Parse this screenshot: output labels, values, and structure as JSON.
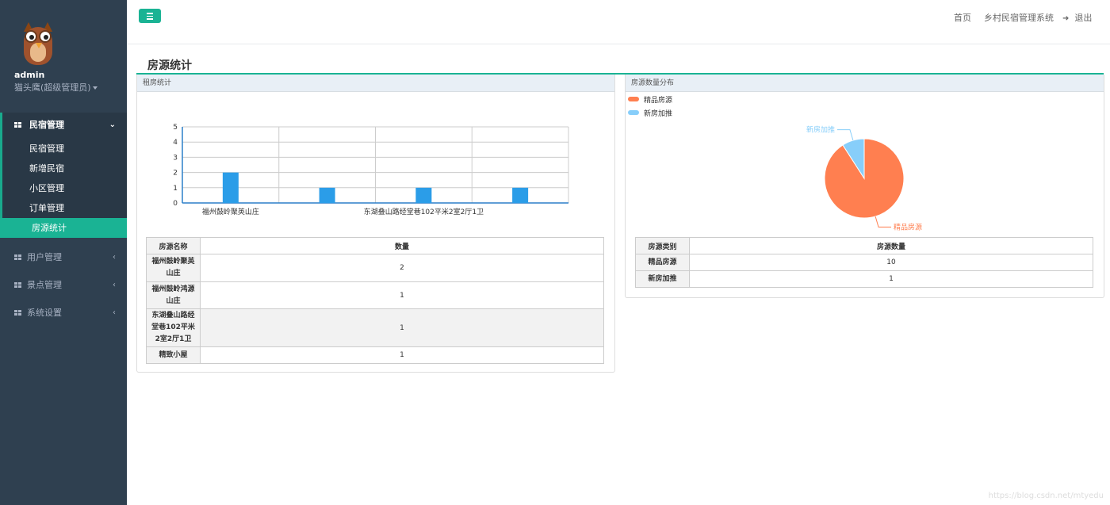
{
  "user": {
    "name": "admin",
    "role": "猫头鹰(超级管理员)"
  },
  "sidebar": {
    "groups": [
      {
        "label": "民宿管理",
        "items": [
          "民宿管理",
          "新增民宿",
          "小区管理",
          "订单管理",
          "房源统计"
        ],
        "active_item": "房源统计"
      },
      {
        "label": "用户管理"
      },
      {
        "label": "景点管理"
      },
      {
        "label": "系统设置"
      }
    ]
  },
  "topbar": {
    "home": "首页",
    "system": "乡村民宿管理系统",
    "logout": "退出"
  },
  "page": {
    "title": "房源统计"
  },
  "left_panel": {
    "title": "租房统计",
    "table": {
      "headers": [
        "房源名称",
        "数量"
      ],
      "rows": [
        {
          "name": "福州鼓岭聚英山庄",
          "count": "2"
        },
        {
          "name": "福州鼓岭鸿源山庄",
          "count": "1"
        },
        {
          "name": "东湖叠山路经堂巷102平米2室2厅1卫",
          "count": "1"
        },
        {
          "name": "精致小屋",
          "count": "1"
        }
      ]
    }
  },
  "right_panel": {
    "title": "房源数量分布",
    "legend": [
      {
        "label": "精品房源",
        "color": "#ff7f50"
      },
      {
        "label": "新房加推",
        "color": "#87cefa"
      }
    ],
    "table": {
      "headers": [
        "房源类别",
        "房源数量"
      ],
      "rows": [
        {
          "name": "精品房源",
          "count": "10"
        },
        {
          "name": "新房加推",
          "count": "1"
        }
      ]
    }
  },
  "chart_data": [
    {
      "type": "bar",
      "categories": [
        "福州鼓岭聚英山庄",
        "福州鼓岭鸿源山庄",
        "东湖叠山路经堂巷102平米2室2厅1卫",
        "精致小屋"
      ],
      "visible_category_labels": [
        "福州鼓岭聚英山庄",
        "",
        "东湖叠山路经堂巷102平米2室2厅1卫",
        ""
      ],
      "values": [
        2,
        1,
        1,
        1
      ],
      "ylim": [
        0,
        5
      ],
      "yticks": [
        "0",
        "1",
        "2",
        "3",
        "4",
        "5"
      ],
      "color": "#2b9de8",
      "grid": true
    },
    {
      "type": "pie",
      "labels": [
        "精品房源",
        "新房加推"
      ],
      "values": [
        10,
        1
      ],
      "colors": [
        "#ff7f50",
        "#87cefa"
      ],
      "legend": "top-left"
    }
  ],
  "watermark": "https://blog.csdn.net/mtyedu"
}
